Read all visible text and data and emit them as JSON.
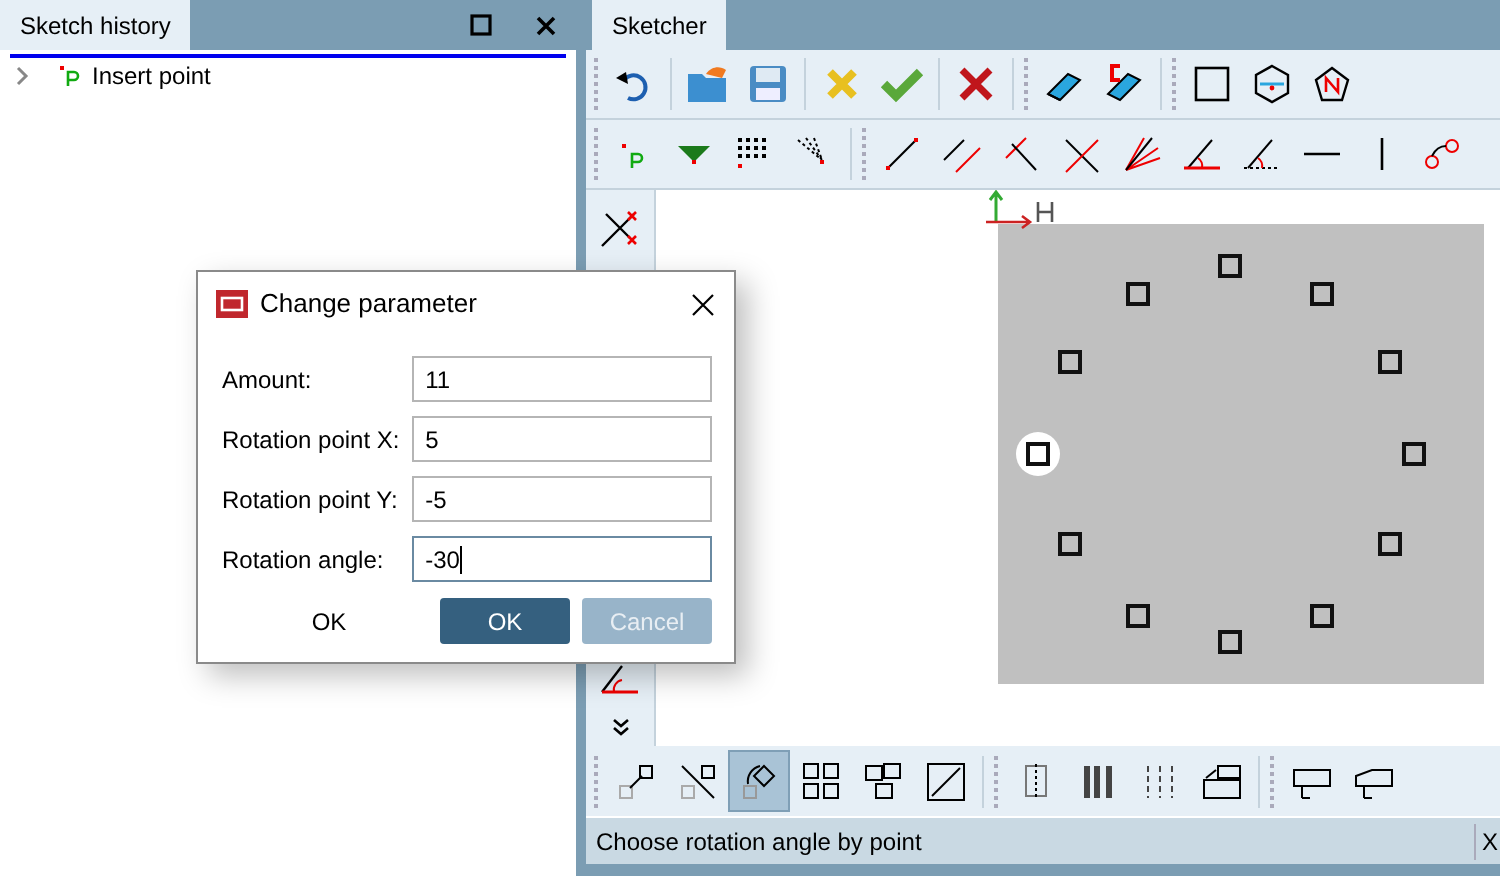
{
  "history_panel": {
    "title": "Sketch history",
    "items": [
      {
        "label": "Insert point",
        "expanded": false
      }
    ]
  },
  "sketcher": {
    "tab": "Sketcher"
  },
  "bottom_tools": [
    {
      "selected": false
    },
    {
      "selected": false
    },
    {
      "selected": true
    },
    {
      "selected": false
    },
    {
      "selected": false
    },
    {
      "selected": false
    },
    {
      "selected": false
    },
    {
      "selected": false
    },
    {
      "selected": false
    },
    {
      "selected": false
    },
    {
      "selected": false
    },
    {
      "selected": false
    }
  ],
  "status_bar": {
    "message": "Choose rotation angle by point",
    "coordinate": "X"
  },
  "dialog": {
    "title": "Change parameter",
    "fields": [
      {
        "label": "Amount:",
        "value": "11",
        "focused": false
      },
      {
        "label": "Rotation point X:",
        "value": "5",
        "focused": false
      },
      {
        "label": "Rotation point Y:",
        "value": "-5",
        "focused": false
      },
      {
        "label": "Rotation angle:",
        "value": "-30",
        "focused": true
      }
    ],
    "link_button": "OK",
    "buttons": [
      {
        "label": "OK",
        "disabled": false
      },
      {
        "label": "Cancel",
        "disabled": true
      }
    ]
  }
}
